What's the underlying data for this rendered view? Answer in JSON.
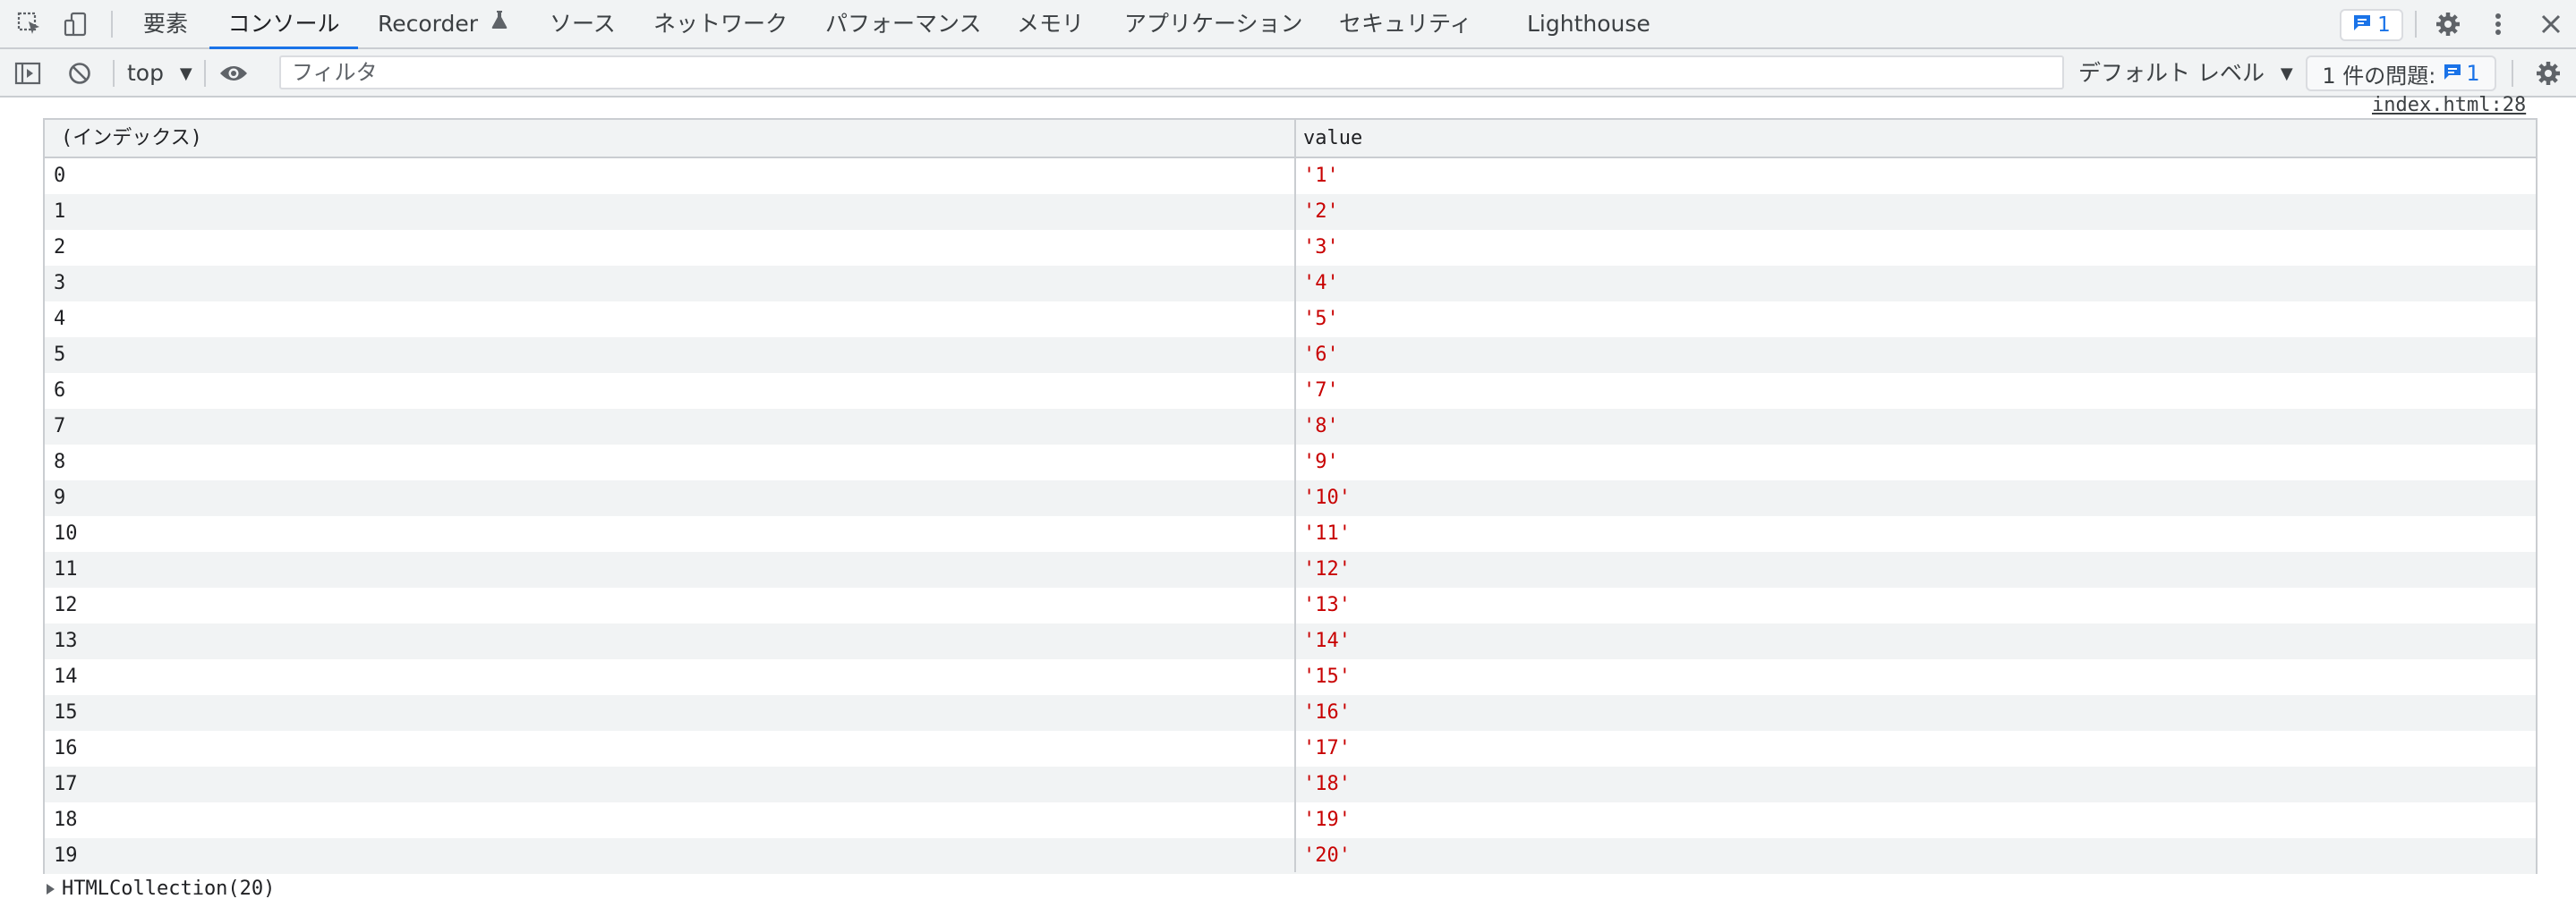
{
  "tabs": [
    {
      "label": "要素",
      "active": false
    },
    {
      "label": "コンソール",
      "active": true
    },
    {
      "label": "Recorder",
      "active": false
    },
    {
      "label": "ソース",
      "active": false
    },
    {
      "label": "ネットワーク",
      "active": false
    },
    {
      "label": "パフォーマンス",
      "active": false
    },
    {
      "label": "メモリ",
      "active": false
    },
    {
      "label": "アプリケーション",
      "active": false
    },
    {
      "label": "セキュリティ",
      "active": false
    },
    {
      "label": "Lighthouse",
      "active": false
    }
  ],
  "tabbar": {
    "issues_count": "1"
  },
  "toolbar": {
    "context": "top",
    "filter_placeholder": "フィルタ",
    "levels": "デフォルト レベル",
    "issues_label": "1 件の問題:",
    "issues_count": "1"
  },
  "console": {
    "source_link": "index.html:28",
    "table": {
      "headers": [
        "(インデックス)",
        "value"
      ],
      "rows": [
        {
          "index": "0",
          "value": "'1'"
        },
        {
          "index": "1",
          "value": "'2'"
        },
        {
          "index": "2",
          "value": "'3'"
        },
        {
          "index": "3",
          "value": "'4'"
        },
        {
          "index": "4",
          "value": "'5'"
        },
        {
          "index": "5",
          "value": "'6'"
        },
        {
          "index": "6",
          "value": "'7'"
        },
        {
          "index": "7",
          "value": "'8'"
        },
        {
          "index": "8",
          "value": "'9'"
        },
        {
          "index": "9",
          "value": "'10'"
        },
        {
          "index": "10",
          "value": "'11'"
        },
        {
          "index": "11",
          "value": "'12'"
        },
        {
          "index": "12",
          "value": "'13'"
        },
        {
          "index": "13",
          "value": "'14'"
        },
        {
          "index": "14",
          "value": "'15'"
        },
        {
          "index": "15",
          "value": "'16'"
        },
        {
          "index": "16",
          "value": "'17'"
        },
        {
          "index": "17",
          "value": "'18'"
        },
        {
          "index": "18",
          "value": "'19'"
        },
        {
          "index": "19",
          "value": "'20'"
        }
      ]
    },
    "collection_label": "HTMLCollection(20)"
  },
  "colors": {
    "accent": "#1a73e8",
    "string_value": "#c80000",
    "toolbar_bg": "#f1f3f4"
  }
}
